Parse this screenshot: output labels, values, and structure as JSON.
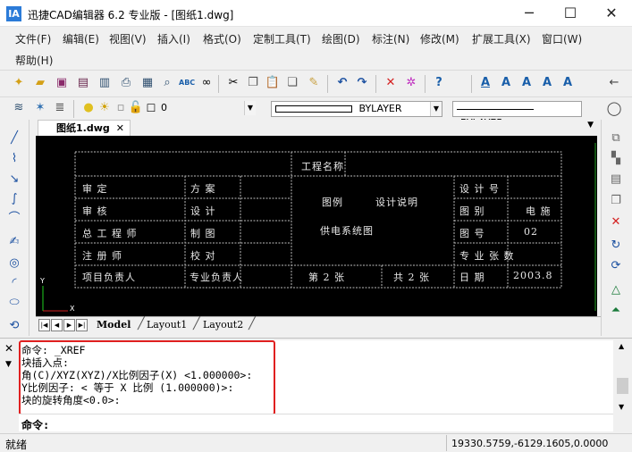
{
  "window": {
    "title": "迅捷CAD编辑器 6.2 专业版 - [图纸1.dwg]",
    "logo": "IA",
    "minimize_icon": "─",
    "maximize_icon": "☐",
    "close_icon": "✕"
  },
  "menu": {
    "items": [
      "文件(F)",
      "编辑(E)",
      "视图(V)",
      "插入(I)",
      "格式(O)",
      "定制工具(T)",
      "绘图(D)",
      "标注(N)",
      "修改(M)",
      "扩展工具(X)",
      "窗口(W)",
      "帮助(H)"
    ]
  },
  "toolbar2": {
    "layer_value": "0",
    "linetype_value": "BYLAYER",
    "lineweight_value": "BYLAYER"
  },
  "document": {
    "tab_label": "图纸1.dwg",
    "tab_close": "✕"
  },
  "drawing": {
    "cells": {
      "project_name": "工程名称",
      "approved": "审    定",
      "scheme": "方    案",
      "design_stage": "设 计 号",
      "checked": "审    核",
      "design": "设    计",
      "drawing_type": "图    别",
      "discipline": "电    施",
      "chief_engineer": "总 工 程 师",
      "drafted": "制    图",
      "drawing_no": "图    号",
      "drawing_no_value": "02",
      "registered_engineer": "注 册 师",
      "proofread": "校    对",
      "major": "专 业 张 数",
      "project_lead": "项目负责人",
      "major_lead": "专业负责人",
      "sheet": "第  2  张",
      "total": "共 2  张",
      "date": "日    期",
      "date_value": "2003.8",
      "legend_title": "图例",
      "design_note": "设计说明",
      "power_system": "供电系统图"
    },
    "axis_y": "Y",
    "axis_x": "X"
  },
  "layout_tabs": [
    "Model",
    "Layout1",
    "Layout2"
  ],
  "command": {
    "log": [
      "命令:  _XREF",
      "块插入点:",
      "角(C)/XYZ(XYZ)/X比例因子(X) <1.000000>:",
      "Y比例因子:  < 等于 X 比例 (1.000000)>:",
      "块的旋转角度<0.0>:"
    ],
    "prompt": "命令:"
  },
  "status": {
    "ready": "就绪",
    "coords": "19330.5759,-6129.1605,0.0000"
  },
  "colors": {
    "canvas": "#000000",
    "highlight_box": "#e02020",
    "accent": "#2b7bd8"
  }
}
